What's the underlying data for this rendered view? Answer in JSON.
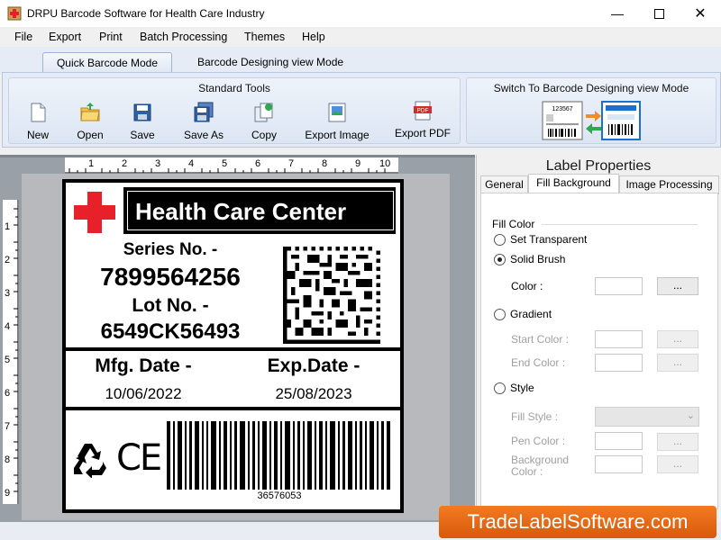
{
  "window": {
    "title": "DRPU Barcode Software for Health Care Industry",
    "minimize_icon": "minimize-icon",
    "maximize_icon": "maximize-icon",
    "close_icon": "close-icon"
  },
  "menu": [
    "File",
    "Export",
    "Print",
    "Batch Processing",
    "Themes",
    "Help"
  ],
  "ribbon_tabs": [
    "Quick Barcode Mode",
    "Barcode Designing view Mode"
  ],
  "standard_tools": {
    "title": "Standard Tools",
    "items": [
      {
        "label": "New",
        "icon": "new-document-icon"
      },
      {
        "label": "Open",
        "icon": "open-folder-icon"
      },
      {
        "label": "Save",
        "icon": "floppy-disk-icon"
      },
      {
        "label": "Save As",
        "icon": "save-as-icon"
      },
      {
        "label": "Copy",
        "icon": "copy-icon"
      },
      {
        "label": "Export Image",
        "icon": "export-image-icon"
      },
      {
        "label": "Export PDF",
        "icon": "pdf-icon"
      }
    ]
  },
  "switch_group": {
    "title": "Switch To Barcode Designing view Mode",
    "icon": "switch-mode-icon",
    "sample_number": "123567"
  },
  "ruler": {
    "h_ticks": [
      "1",
      "2",
      "3",
      "4",
      "5",
      "6",
      "7",
      "8",
      "9",
      "10"
    ],
    "v_ticks": [
      "1",
      "2",
      "3",
      "4",
      "5",
      "6",
      "7",
      "8",
      "9"
    ]
  },
  "label": {
    "header": "Health Care Center",
    "series_label": "Series No. -",
    "series_value": "7899564256",
    "lot_label": "Lot No. -",
    "lot_value": "6549CK56493",
    "mfg_label": "Mfg. Date -",
    "mfg_value": "10/06/2022",
    "exp_label": "Exp.Date -",
    "exp_value": "25/08/2023",
    "barcode_number": "36576053",
    "ce_mark": "CE",
    "icons": [
      "red-cross-icon",
      "recycle-icon",
      "ce-mark-icon",
      "datamatrix-barcode",
      "linear-barcode"
    ]
  },
  "properties": {
    "title": "Label Properties",
    "tabs": [
      "General",
      "Fill Background",
      "Image Processing"
    ],
    "active_tab": "Fill Background",
    "section": "Fill Color",
    "options": {
      "transparent": "Set Transparent",
      "solid": "Solid Brush",
      "gradient": "Gradient",
      "style": "Style"
    },
    "selected_option": "Solid Brush",
    "fields": {
      "color": "Color :",
      "start_color": "Start Color :",
      "end_color": "End Color :",
      "fill_style": "Fill Style :",
      "pen_color": "Pen Color :",
      "bg_color_1": "Background",
      "bg_color_2": "Color :"
    },
    "dots": "..."
  },
  "watermark": "TradeLabelSoftware.com",
  "colors": {
    "accent": "#f47a22",
    "red_cross": "#e8202a",
    "ribbon": "#e4ebf6"
  }
}
